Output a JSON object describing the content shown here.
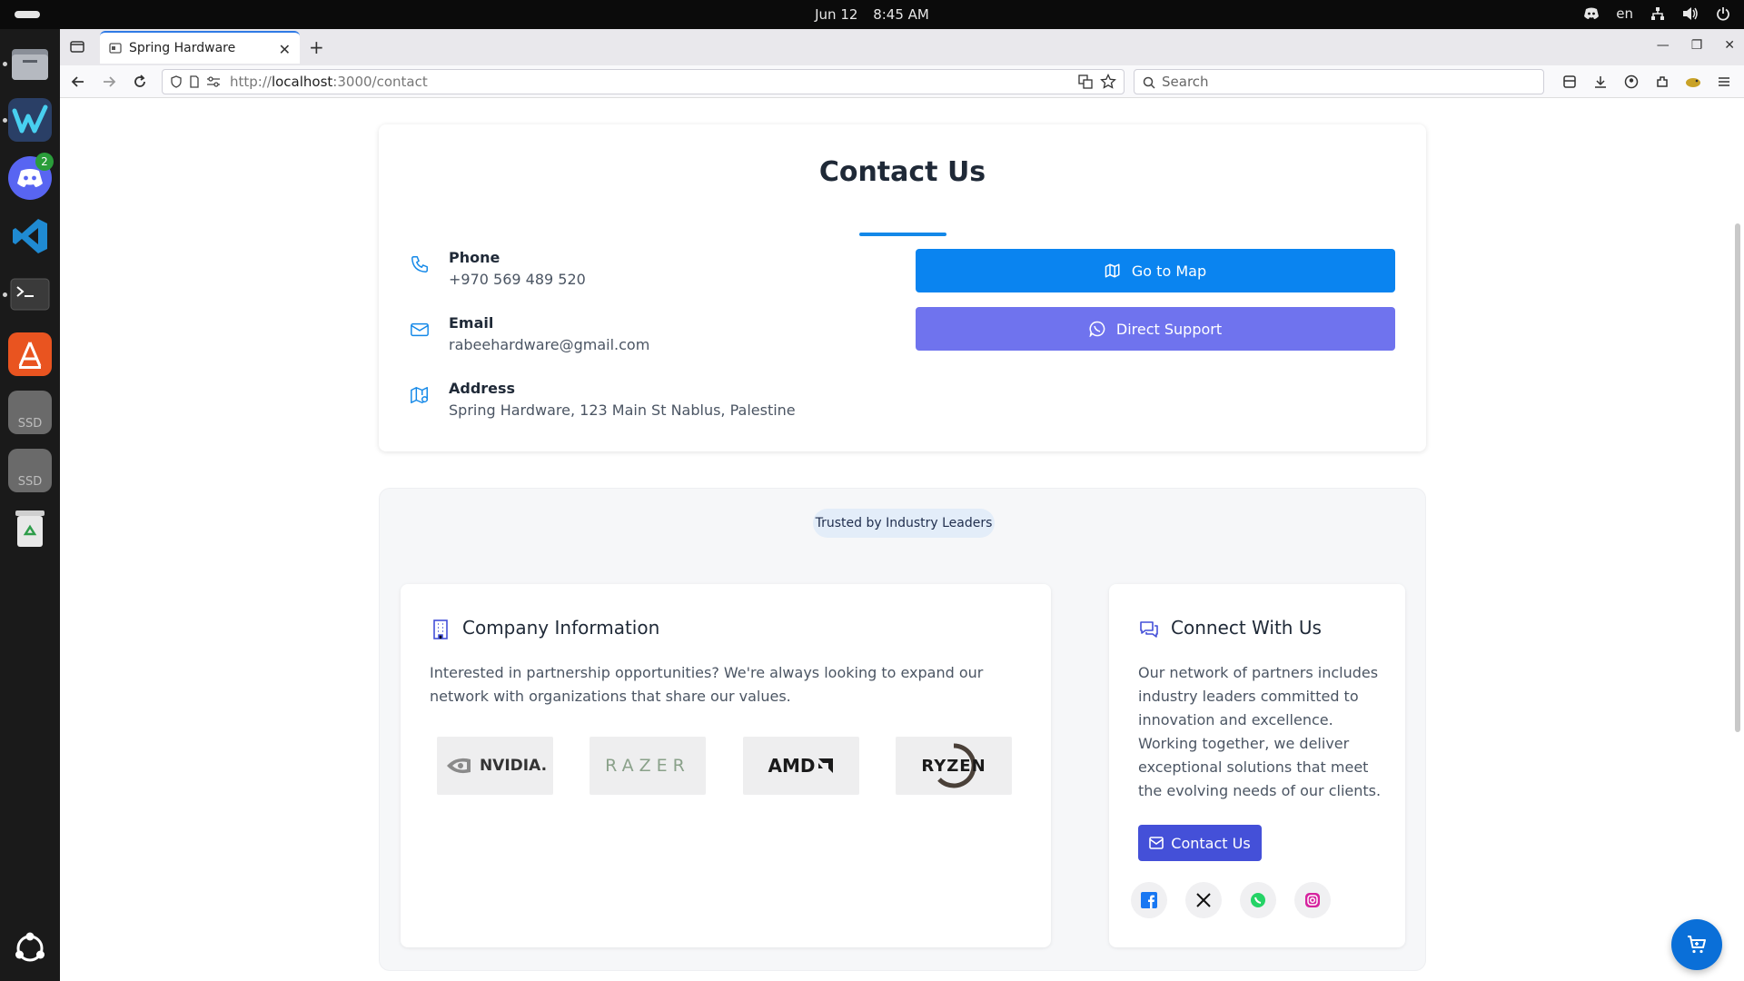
{
  "system": {
    "date": "Jun 12",
    "time": "8:45 AM",
    "language": "en"
  },
  "dock": {
    "apps": [
      "files-app-icon",
      "windsurf-app-icon",
      "discord-app-icon",
      "vscode-app-icon",
      "terminal-app-icon",
      "app-center-icon",
      "ssd-drive-icon",
      "ssd-drive-icon",
      "trash-icon",
      "show-apps-icon"
    ],
    "discord_badge": "2",
    "ssd_label_1": "SSD",
    "ssd_label_2": "SSD"
  },
  "browser": {
    "tab_title": "Spring Hardware",
    "url_prefix": "http://",
    "url_host": "localhost",
    "url_path": ":3000/contact",
    "search_placeholder": "Search"
  },
  "contact": {
    "title": "Contact Us",
    "phone_label": "Phone",
    "phone_value": "+970 569 489 520",
    "email_label": "Email",
    "email_value": "rabeehardware@gmail.com",
    "address_label": "Address",
    "address_value": "Spring Hardware, 123 Main St Nablus, Palestine",
    "map_button": "Go to Map",
    "support_button": "Direct Support",
    "accent_color": "#0a84f0",
    "support_color": "#6f73ee"
  },
  "partners": {
    "pill": "Trusted by Industry Leaders",
    "company_title": "Company Information",
    "company_text": "Interested in partnership opportunities? We're always looking to expand our network with organizations that share our values.",
    "logos": [
      "NVIDIA.",
      "RAZER",
      "AMD",
      "RYZEN"
    ],
    "connect_title": "Connect With Us",
    "connect_text": "Our network of partners includes industry leaders committed to innovation and excellence. Working together, we deliver exceptional solutions that meet the evolving needs of our clients.",
    "contact_button": "Contact Us",
    "socials": [
      "facebook-icon",
      "x-icon",
      "whatsapp-icon",
      "instagram-icon"
    ]
  }
}
